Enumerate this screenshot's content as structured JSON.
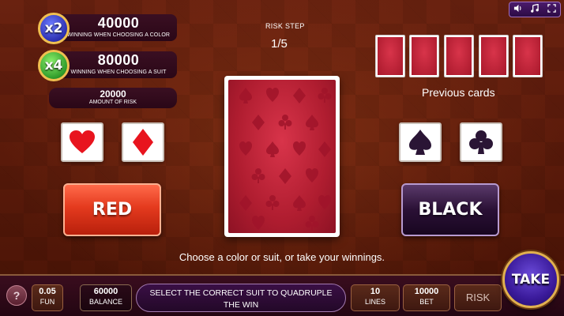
{
  "multipliers": [
    {
      "badge": "x2",
      "value": "40000",
      "label": "WINNING WHEN CHOOSING A COLOR"
    },
    {
      "badge": "x4",
      "value": "80000",
      "label": "WINNING WHEN CHOOSING A SUIT"
    }
  ],
  "risk_amount": {
    "value": "20000",
    "label": "AMOUNT OF RISK"
  },
  "risk_step": {
    "label": "RISK STEP",
    "value": "1/5"
  },
  "previous_cards": {
    "label": "Previous cards",
    "count": 5
  },
  "buttons": {
    "red": "RED",
    "black": "BLACK",
    "take": "TAKE"
  },
  "instruction": "Choose a color or suit, or take your winnings.",
  "bottom_bar": {
    "help": "?",
    "fun": {
      "value": "0.05",
      "label": "FUN"
    },
    "balance": {
      "value": "60000",
      "label": "BALANCE"
    },
    "message": {
      "line1": "SELECT THE CORRECT SUIT TO QUADRUPLE",
      "line2": "THE WIN"
    },
    "lines": {
      "value": "10",
      "label": "LINES"
    },
    "bet": {
      "value": "10000",
      "label": "BET"
    },
    "risk": "RISK"
  },
  "colors": {
    "red": "#e43a1e",
    "card_back": "#b01d30",
    "gold": "#e0b050"
  },
  "icons": [
    "speaker-icon",
    "music-note-icon",
    "fullscreen-icon",
    "heart-icon",
    "diamond-icon",
    "spade-icon",
    "club-icon"
  ]
}
